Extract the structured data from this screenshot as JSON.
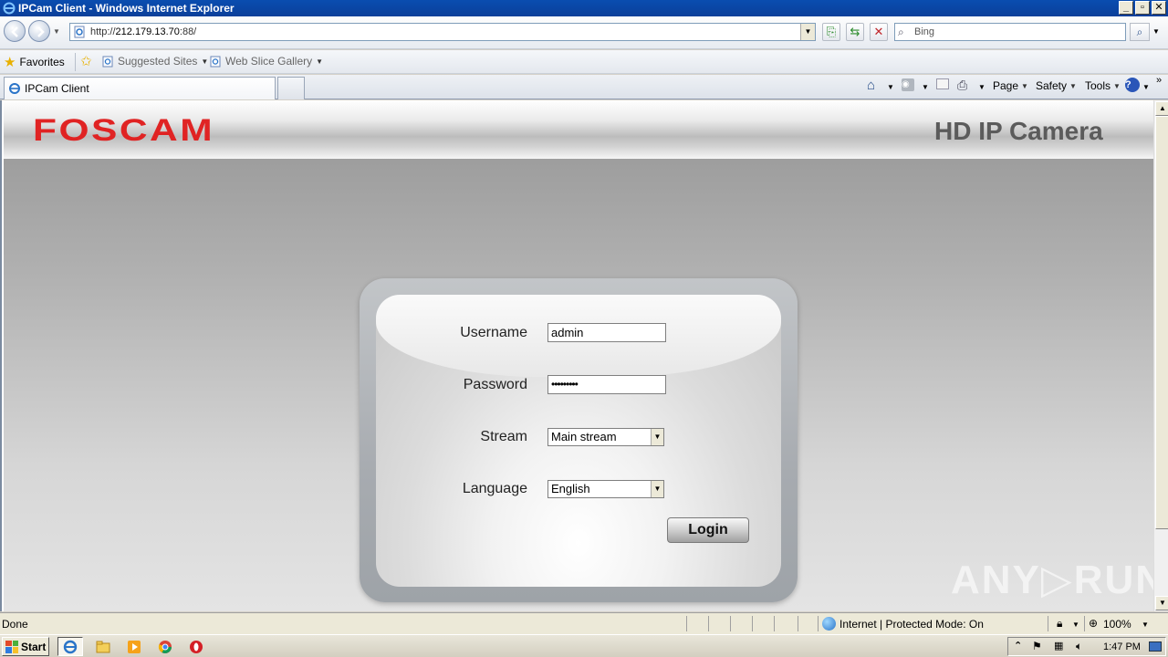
{
  "window": {
    "title": "IPCam Client - Windows Internet Explorer",
    "min_label": "_",
    "max_label": "▫",
    "close_label": "✕"
  },
  "address": {
    "scheme": "http://",
    "host": "212.179.13.70",
    "port_path": ":88/"
  },
  "search": {
    "placeholder": "Bing"
  },
  "favorites": {
    "label": "Favorites",
    "links": [
      {
        "label": "Suggested Sites"
      },
      {
        "label": "Web Slice Gallery"
      }
    ]
  },
  "tab": {
    "label": "IPCam Client"
  },
  "commands": {
    "page": "Page",
    "safety": "Safety",
    "tools": "Tools"
  },
  "page": {
    "logo": "FOSCAM",
    "title": "HD IP Camera",
    "form": {
      "username_label": "Username",
      "username_value": "admin",
      "password_label": "Password",
      "password_value": "•••••••••",
      "stream_label": "Stream",
      "stream_value": "Main stream",
      "language_label": "Language",
      "language_value": "English",
      "login_label": "Login"
    },
    "watermark": "ANY▷RUN"
  },
  "status": {
    "text": "Done",
    "zone": "Internet | Protected Mode: On",
    "zoom": "100%"
  },
  "taskbar": {
    "start_label": "Start",
    "clock": "1:47 PM"
  },
  "colors": {
    "logo_red": "#e02323",
    "title_gray": "#5b5b5b",
    "titlebar_blue": "#0a4db0"
  }
}
